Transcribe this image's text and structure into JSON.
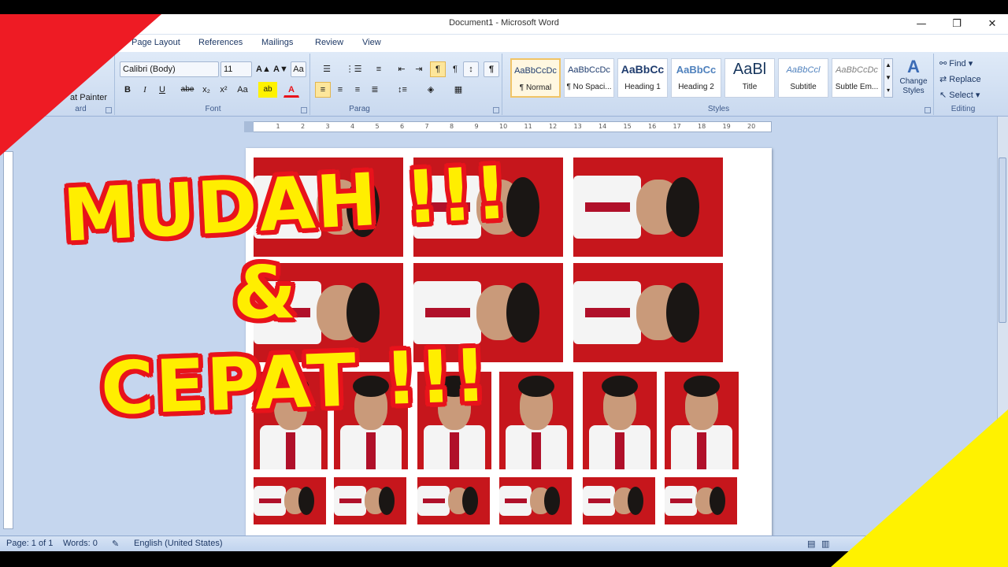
{
  "window": {
    "title": "Document1 - Microsoft Word",
    "minimize": "—",
    "maximize": "❐",
    "close": "✕"
  },
  "tabs": [
    "Page Layout",
    "References",
    "Mailings",
    "Review",
    "View"
  ],
  "ribbon": {
    "clipboard": {
      "format_painter": "at Painter",
      "label": "ard"
    },
    "font": {
      "font_name": "Calibri (Body)",
      "font_size": "11",
      "grow": "A▲",
      "shrink": "A▼",
      "clear": "Aa",
      "bold": "B",
      "italic": "I",
      "underline": "U",
      "strike": "abe",
      "subscript": "x₂",
      "superscript": "x²",
      "change_case": "Aa",
      "highlight": "ab",
      "font_color": "A",
      "label": "Font"
    },
    "paragraph": {
      "label": "Parag"
    },
    "styles": {
      "label": "Styles",
      "items": [
        {
          "sample": "AaBbCcDc",
          "name": "¶ Normal"
        },
        {
          "sample": "AaBbCcDc",
          "name": "¶ No Spaci..."
        },
        {
          "sample": "AaBbCc",
          "name": "Heading 1"
        },
        {
          "sample": "AaBbCc",
          "name": "Heading 2"
        },
        {
          "sample": "AaBl",
          "name": "Title"
        },
        {
          "sample": "AaBbCcl",
          "name": "Subtitle"
        },
        {
          "sample": "AaBbCcDc",
          "name": "Subtle Em..."
        }
      ],
      "change_styles": "Change Styles"
    },
    "editing": {
      "find": "Find",
      "replace": "Replace",
      "select": "Select",
      "label": "Editing"
    }
  },
  "ruler": {
    "ticks": [
      "1",
      "2",
      "3",
      "4",
      "5",
      "6",
      "7",
      "8",
      "9",
      "10",
      "11",
      "12",
      "13",
      "14",
      "15",
      "16",
      "17",
      "18",
      "19",
      "20"
    ]
  },
  "status": {
    "page": "Page: 1 of 1",
    "words": "Words: 0",
    "language": "English (United States)"
  },
  "overlay": {
    "line1": "MUDAH !!!",
    "line2": "&",
    "line3": "CEPAT !!!"
  },
  "colors": {
    "accent_red": "#e8131b",
    "accent_yellow": "#ffee00",
    "photo_background": "#c6161c"
  }
}
